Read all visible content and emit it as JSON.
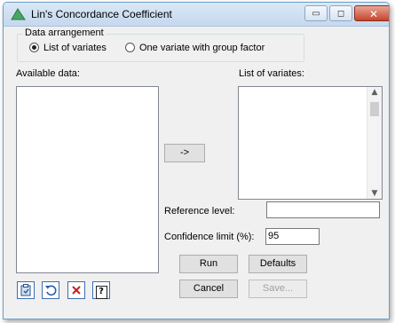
{
  "window": {
    "title": "Lin's Concordance Coefficient",
    "controls": {
      "minimize": "▭",
      "maximize": "◻",
      "close": "✕"
    }
  },
  "data_arrangement": {
    "label": "Data arrangement",
    "options": [
      {
        "label": "List of variates",
        "selected": true
      },
      {
        "label": "One variate with group factor",
        "selected": false
      }
    ]
  },
  "available_data": {
    "label": "Available data:",
    "items": []
  },
  "list_of_variates": {
    "label": "List of variates:",
    "items": []
  },
  "move_button": {
    "label": "->"
  },
  "reference_level": {
    "label": "Reference level:",
    "value": ""
  },
  "confidence_limit": {
    "label": "Confidence limit (%):",
    "value": "95"
  },
  "buttons": {
    "run": "Run",
    "defaults": "Defaults",
    "cancel": "Cancel",
    "save": "Save..."
  },
  "toolbar": {
    "icons": [
      "clipboard-icon",
      "undo-icon",
      "clear-icon",
      "help-icon"
    ],
    "help_glyph": "?"
  }
}
